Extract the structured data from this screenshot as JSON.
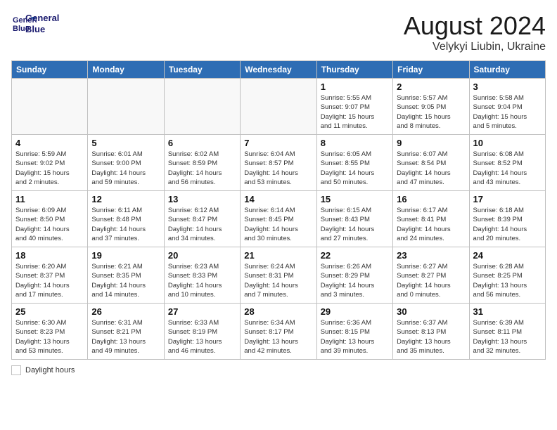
{
  "header": {
    "logo_line1": "General",
    "logo_line2": "Blue",
    "month_year": "August 2024",
    "location": "Velykyi Liubin, Ukraine"
  },
  "legend": {
    "label": "Daylight hours"
  },
  "days_of_week": [
    "Sunday",
    "Monday",
    "Tuesday",
    "Wednesday",
    "Thursday",
    "Friday",
    "Saturday"
  ],
  "weeks": [
    [
      {
        "day": "",
        "info": ""
      },
      {
        "day": "",
        "info": ""
      },
      {
        "day": "",
        "info": ""
      },
      {
        "day": "",
        "info": ""
      },
      {
        "day": "1",
        "info": "Sunrise: 5:55 AM\nSunset: 9:07 PM\nDaylight: 15 hours\nand 11 minutes."
      },
      {
        "day": "2",
        "info": "Sunrise: 5:57 AM\nSunset: 9:05 PM\nDaylight: 15 hours\nand 8 minutes."
      },
      {
        "day": "3",
        "info": "Sunrise: 5:58 AM\nSunset: 9:04 PM\nDaylight: 15 hours\nand 5 minutes."
      }
    ],
    [
      {
        "day": "4",
        "info": "Sunrise: 5:59 AM\nSunset: 9:02 PM\nDaylight: 15 hours\nand 2 minutes."
      },
      {
        "day": "5",
        "info": "Sunrise: 6:01 AM\nSunset: 9:00 PM\nDaylight: 14 hours\nand 59 minutes."
      },
      {
        "day": "6",
        "info": "Sunrise: 6:02 AM\nSunset: 8:59 PM\nDaylight: 14 hours\nand 56 minutes."
      },
      {
        "day": "7",
        "info": "Sunrise: 6:04 AM\nSunset: 8:57 PM\nDaylight: 14 hours\nand 53 minutes."
      },
      {
        "day": "8",
        "info": "Sunrise: 6:05 AM\nSunset: 8:55 PM\nDaylight: 14 hours\nand 50 minutes."
      },
      {
        "day": "9",
        "info": "Sunrise: 6:07 AM\nSunset: 8:54 PM\nDaylight: 14 hours\nand 47 minutes."
      },
      {
        "day": "10",
        "info": "Sunrise: 6:08 AM\nSunset: 8:52 PM\nDaylight: 14 hours\nand 43 minutes."
      }
    ],
    [
      {
        "day": "11",
        "info": "Sunrise: 6:09 AM\nSunset: 8:50 PM\nDaylight: 14 hours\nand 40 minutes."
      },
      {
        "day": "12",
        "info": "Sunrise: 6:11 AM\nSunset: 8:48 PM\nDaylight: 14 hours\nand 37 minutes."
      },
      {
        "day": "13",
        "info": "Sunrise: 6:12 AM\nSunset: 8:47 PM\nDaylight: 14 hours\nand 34 minutes."
      },
      {
        "day": "14",
        "info": "Sunrise: 6:14 AM\nSunset: 8:45 PM\nDaylight: 14 hours\nand 30 minutes."
      },
      {
        "day": "15",
        "info": "Sunrise: 6:15 AM\nSunset: 8:43 PM\nDaylight: 14 hours\nand 27 minutes."
      },
      {
        "day": "16",
        "info": "Sunrise: 6:17 AM\nSunset: 8:41 PM\nDaylight: 14 hours\nand 24 minutes."
      },
      {
        "day": "17",
        "info": "Sunrise: 6:18 AM\nSunset: 8:39 PM\nDaylight: 14 hours\nand 20 minutes."
      }
    ],
    [
      {
        "day": "18",
        "info": "Sunrise: 6:20 AM\nSunset: 8:37 PM\nDaylight: 14 hours\nand 17 minutes."
      },
      {
        "day": "19",
        "info": "Sunrise: 6:21 AM\nSunset: 8:35 PM\nDaylight: 14 hours\nand 14 minutes."
      },
      {
        "day": "20",
        "info": "Sunrise: 6:23 AM\nSunset: 8:33 PM\nDaylight: 14 hours\nand 10 minutes."
      },
      {
        "day": "21",
        "info": "Sunrise: 6:24 AM\nSunset: 8:31 PM\nDaylight: 14 hours\nand 7 minutes."
      },
      {
        "day": "22",
        "info": "Sunrise: 6:26 AM\nSunset: 8:29 PM\nDaylight: 14 hours\nand 3 minutes."
      },
      {
        "day": "23",
        "info": "Sunrise: 6:27 AM\nSunset: 8:27 PM\nDaylight: 14 hours\nand 0 minutes."
      },
      {
        "day": "24",
        "info": "Sunrise: 6:28 AM\nSunset: 8:25 PM\nDaylight: 13 hours\nand 56 minutes."
      }
    ],
    [
      {
        "day": "25",
        "info": "Sunrise: 6:30 AM\nSunset: 8:23 PM\nDaylight: 13 hours\nand 53 minutes."
      },
      {
        "day": "26",
        "info": "Sunrise: 6:31 AM\nSunset: 8:21 PM\nDaylight: 13 hours\nand 49 minutes."
      },
      {
        "day": "27",
        "info": "Sunrise: 6:33 AM\nSunset: 8:19 PM\nDaylight: 13 hours\nand 46 minutes."
      },
      {
        "day": "28",
        "info": "Sunrise: 6:34 AM\nSunset: 8:17 PM\nDaylight: 13 hours\nand 42 minutes."
      },
      {
        "day": "29",
        "info": "Sunrise: 6:36 AM\nSunset: 8:15 PM\nDaylight: 13 hours\nand 39 minutes."
      },
      {
        "day": "30",
        "info": "Sunrise: 6:37 AM\nSunset: 8:13 PM\nDaylight: 13 hours\nand 35 minutes."
      },
      {
        "day": "31",
        "info": "Sunrise: 6:39 AM\nSunset: 8:11 PM\nDaylight: 13 hours\nand 32 minutes."
      }
    ]
  ]
}
